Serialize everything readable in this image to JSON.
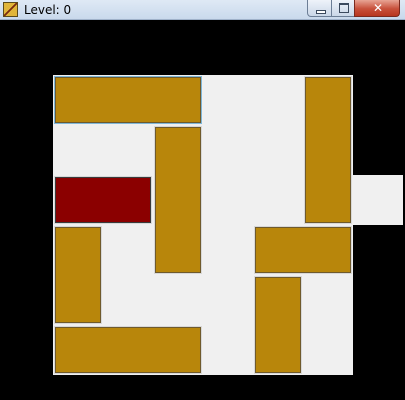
{
  "window": {
    "title": "Level: 0",
    "ghost_text": [
      "",
      "",
      ""
    ],
    "close_glyph": "✕"
  },
  "board": {
    "cols": 6,
    "rows": 6,
    "exit": {
      "row": 2,
      "side": "right"
    },
    "colors": {
      "background": "#000000",
      "board": "#f0f0f0",
      "block": "#b8860b",
      "target_block": "#8b0000",
      "selected_outline": "#7fb7d9"
    },
    "blocks": [
      {
        "name": "block-horizontal-1",
        "row": 0,
        "col": 0,
        "len": 3,
        "dir": "h",
        "target": false,
        "selected": true
      },
      {
        "name": "block-vertical-1",
        "row": 0,
        "col": 5,
        "len": 3,
        "dir": "v",
        "target": false
      },
      {
        "name": "block-vertical-2",
        "row": 1,
        "col": 2,
        "len": 3,
        "dir": "v",
        "target": false
      },
      {
        "name": "target-block",
        "row": 2,
        "col": 0,
        "len": 2,
        "dir": "h",
        "target": true
      },
      {
        "name": "block-vertical-3",
        "row": 3,
        "col": 0,
        "len": 2,
        "dir": "v",
        "target": false
      },
      {
        "name": "block-horizontal-2",
        "row": 3,
        "col": 4,
        "len": 2,
        "dir": "h",
        "target": false
      },
      {
        "name": "block-vertical-4",
        "row": 4,
        "col": 4,
        "len": 2,
        "dir": "v",
        "target": false
      },
      {
        "name": "block-horizontal-3",
        "row": 5,
        "col": 0,
        "len": 3,
        "dir": "h",
        "target": false
      }
    ]
  }
}
